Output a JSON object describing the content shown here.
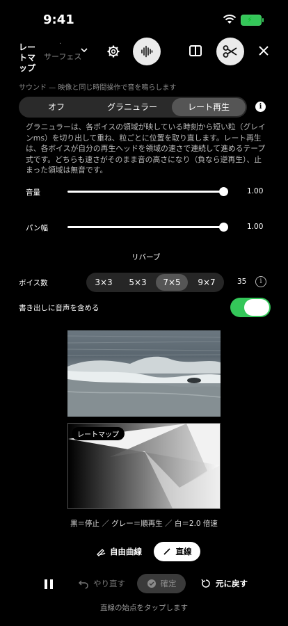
{
  "status": {
    "time": "9:41"
  },
  "header": {
    "title": "レートマップ",
    "dot": "·",
    "subtitle": "サーフェス"
  },
  "caption": "サウンド — 映像と同じ時間操作で音を鳴らします",
  "mode": {
    "options": [
      "オフ",
      "グラニュラー",
      "レート再生"
    ],
    "selected": "レート再生"
  },
  "description": "グラニュラーは、各ボイスの領域が映している時刻から短い粒（グレインms）を切り出して重ね、粒ごとに位置を取り直します。レート再生は、各ボイスが自分の再生ヘッドを領域の速さで連続して進めるテープ式です。どちらも速さがそのまま音の高さになり（負なら逆再生）、止まった領域は無音です。",
  "volume": {
    "label": "音量",
    "value": "1.00",
    "level": 1.0
  },
  "pan": {
    "label": "パン幅",
    "value": "1.00",
    "level": 1.0
  },
  "reverb": {
    "label": "リバーブ"
  },
  "voices": {
    "label": "ボイス数",
    "options": [
      "3×3",
      "5×3",
      "7×5",
      "9×7"
    ],
    "selected": "7×5",
    "count": "35"
  },
  "export": {
    "label": "書き出しに音声を含める",
    "on": true
  },
  "ratemap": {
    "label": "レートマップ"
  },
  "legend": "黒＝停止 ／ グレー＝順再生 ／ 白＝2.0 倍速",
  "draw_modes": {
    "freehand": "自由曲線",
    "line": "直線",
    "selected": "直線"
  },
  "controls": {
    "redo": "やり直す",
    "confirm": "確定",
    "undo": "元に戻す"
  },
  "hint": "直線の始点をタップします",
  "colors": {
    "accent_green": "#34c759",
    "segment_bg": "#2a2a2a",
    "segment_on": "#555555"
  }
}
